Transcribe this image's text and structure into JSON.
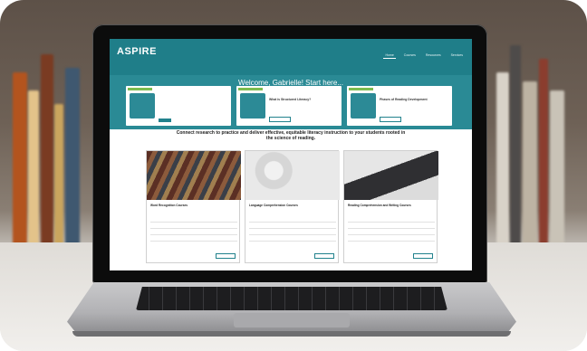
{
  "colors": {
    "nav": "#1f7e89",
    "hero": "#2a8a95",
    "accent": "#22828d",
    "tag": "#7dbb4f"
  },
  "header": {
    "logo": "ASPIRE",
    "logo_sub": "",
    "nav": [
      "Home",
      "Courses",
      "Resources",
      "Services"
    ]
  },
  "welcome": "Welcome, Gabrielle! Start here...",
  "cards": [
    {
      "tag": "",
      "label": "",
      "title": "",
      "button": "",
      "meta": ""
    },
    {
      "tag": "",
      "label": "",
      "title": "What is Structured Literacy?",
      "button": "",
      "meta": ""
    },
    {
      "tag": "",
      "label": "",
      "title": "Phases of Reading Development",
      "button": "",
      "meta": ""
    }
  ],
  "tagline": "Connect research to practice and deliver effective, equitable literacy instruction to your students rooted in the science of reading.",
  "courses": [
    {
      "title": "Word Recognition Courses",
      "desc": "",
      "items": [
        "",
        "",
        "",
        ""
      ],
      "button": "",
      "meta": ""
    },
    {
      "title": "Language Comprehension Courses",
      "desc": "",
      "items": [
        "",
        "",
        "",
        ""
      ],
      "button": "",
      "meta": ""
    },
    {
      "title": "Reading Comprehension and Writing Courses",
      "desc": "",
      "items": [
        "",
        "",
        "",
        ""
      ],
      "button": "",
      "meta": ""
    }
  ],
  "footer": ""
}
